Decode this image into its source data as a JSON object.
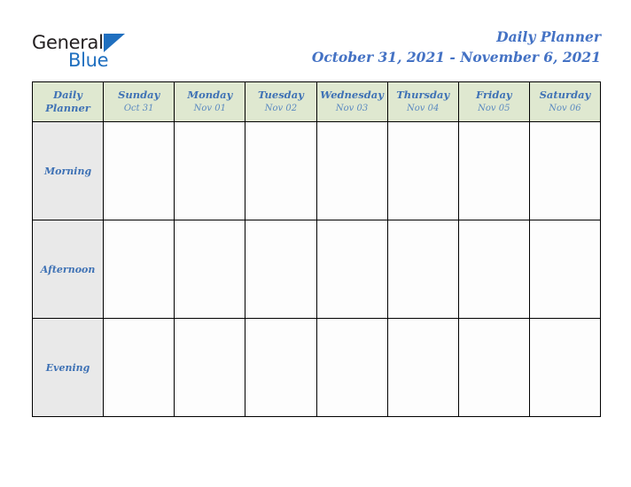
{
  "brand": {
    "word_dark": "General",
    "word_blue": "Blue",
    "triangle_color": "#1f6fbf",
    "dark_color": "#231f20"
  },
  "header": {
    "title": "Daily Planner",
    "subtitle": "October 31, 2021 - November 6, 2021",
    "accent_color": "#4472c4"
  },
  "table": {
    "corner": {
      "line1": "Daily",
      "line2": "Planner"
    },
    "header_bg": "#dfe8d0",
    "rowlabel_bg": "#e9e9e9",
    "text_color": "#3f72b5",
    "columns": [
      {
        "dayname": "Sunday",
        "daydate": "Oct 31"
      },
      {
        "dayname": "Monday",
        "daydate": "Nov 01"
      },
      {
        "dayname": "Tuesday",
        "daydate": "Nov 02"
      },
      {
        "dayname": "Wednesday",
        "daydate": "Nov 03"
      },
      {
        "dayname": "Thursday",
        "daydate": "Nov 04"
      },
      {
        "dayname": "Friday",
        "daydate": "Nov 05"
      },
      {
        "dayname": "Saturday",
        "daydate": "Nov 06"
      }
    ],
    "rows": [
      {
        "label": "Morning",
        "cells": [
          "",
          "",
          "",
          "",
          "",
          "",
          ""
        ]
      },
      {
        "label": "Afternoon",
        "cells": [
          "",
          "",
          "",
          "",
          "",
          "",
          ""
        ]
      },
      {
        "label": "Evening",
        "cells": [
          "",
          "",
          "",
          "",
          "",
          "",
          ""
        ]
      }
    ]
  }
}
